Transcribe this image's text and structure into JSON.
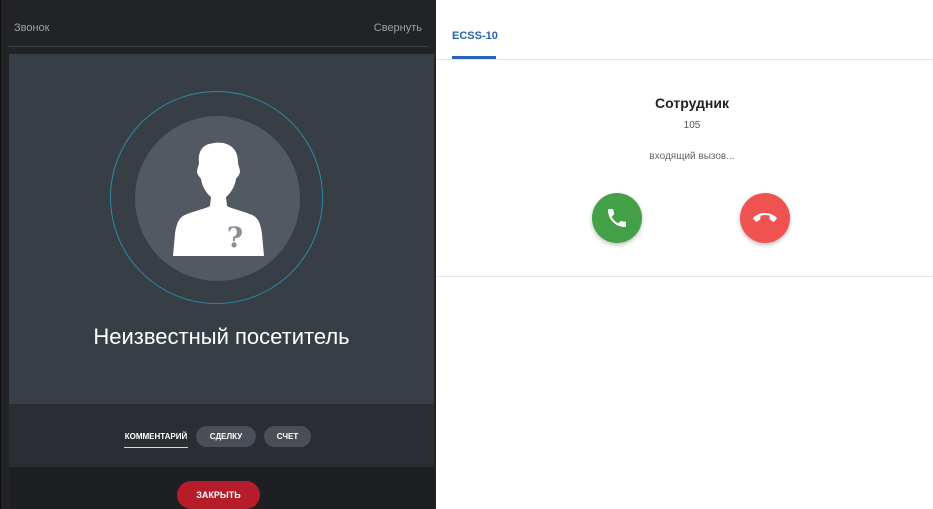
{
  "call_panel": {
    "title": "Звонок",
    "collapse_label": "Свернуть",
    "caller_name": "Неизвестный посетитель",
    "tabs": [
      {
        "label": "КОММЕНТАРИЙ",
        "active": true
      },
      {
        "label": "СДЕЛКУ",
        "active": false
      },
      {
        "label": "СЧЕТ",
        "active": false
      }
    ],
    "close_label": "ЗАКРЫТЬ"
  },
  "phone_panel": {
    "tab_label": "ECSS-10",
    "contact_name": "Сотрудник",
    "contact_number": "105",
    "call_status": "входящий вызов...",
    "accept_icon": "phone-accept-icon",
    "decline_icon": "phone-hangup-icon"
  },
  "colors": {
    "accept": "#43a047",
    "decline": "#ef5350",
    "close_button": "#b71c2b",
    "accent_tab": "#2764b9",
    "ring": "#2c8ba4"
  }
}
